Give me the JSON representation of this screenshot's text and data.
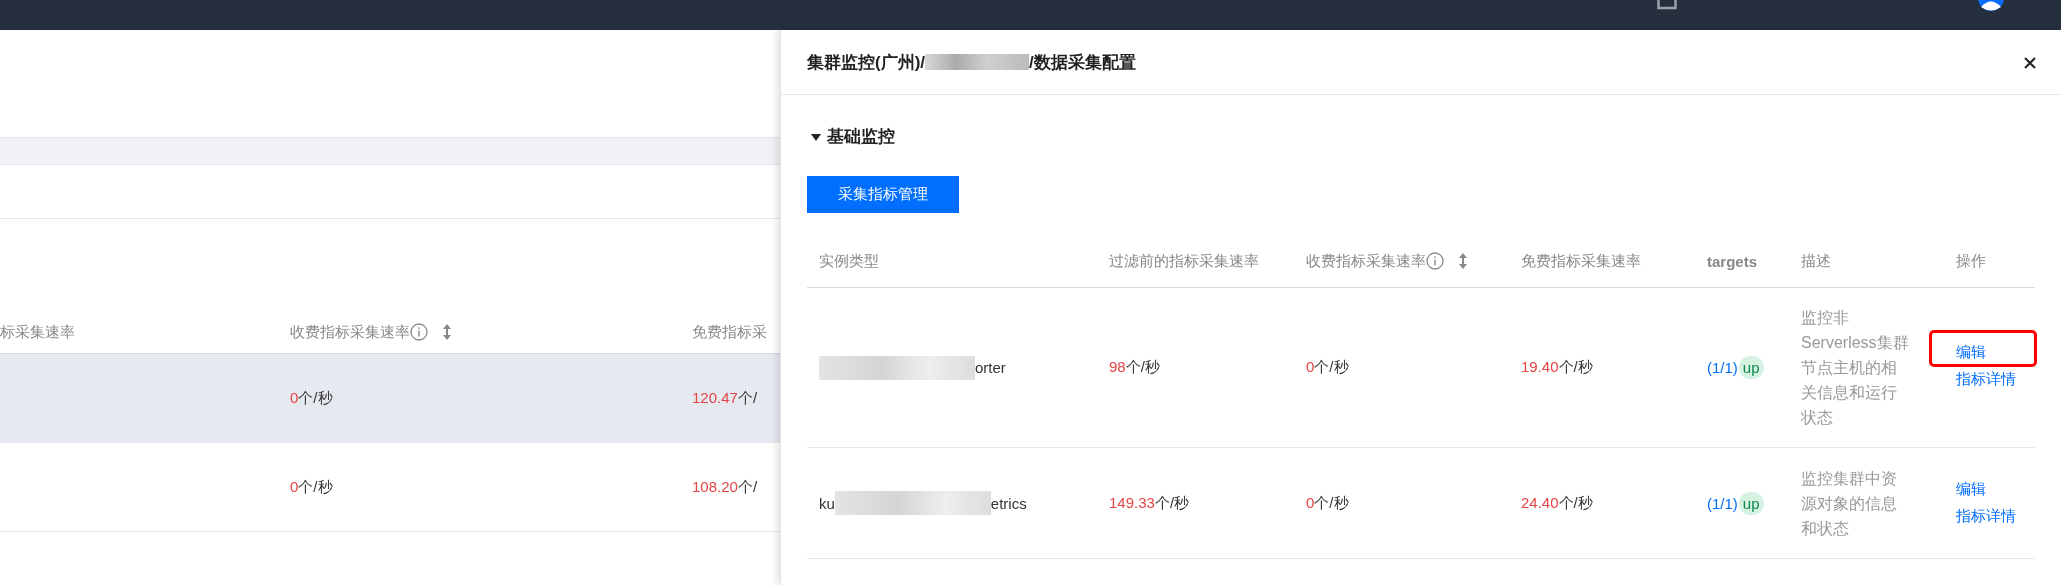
{
  "background_table": {
    "columns": [
      {
        "label": "标采集速率",
        "info": false,
        "sortable": false
      },
      {
        "label": "收费指标采集速率",
        "info": true,
        "sortable": true
      },
      {
        "label": "免费指标采",
        "info": false,
        "sortable": false
      }
    ],
    "rows": [
      {
        "highlighted": true,
        "paid": {
          "value": "0",
          "unit": "个/秒"
        },
        "free": {
          "value": "120.47",
          "unit": "个/"
        }
      },
      {
        "highlighted": false,
        "paid": {
          "value": "0",
          "unit": "个/秒"
        },
        "free": {
          "value": "108.20",
          "unit": "个/"
        }
      }
    ]
  },
  "drawer": {
    "title_before": "集群监控(广州)/",
    "title_after": "/数据采集配置",
    "section": {
      "title": "基础监控",
      "expanded": true
    },
    "button": "采集指标管理",
    "table": {
      "columns": [
        {
          "label": "实例类型",
          "info": false,
          "sortable": false,
          "bold": false
        },
        {
          "label": "过滤前的指标采集速率",
          "info": false,
          "sortable": false,
          "bold": false
        },
        {
          "label": "收费指标采集速率",
          "info": true,
          "sortable": true,
          "bold": false
        },
        {
          "label": "免费指标采集速率",
          "info": false,
          "sortable": false,
          "bold": false
        },
        {
          "label": "targets",
          "info": false,
          "sortable": false,
          "bold": true
        },
        {
          "label": "描述",
          "info": false,
          "sortable": false,
          "bold": false
        },
        {
          "label": "操作",
          "info": false,
          "sortable": false,
          "bold": false
        }
      ],
      "rows": [
        {
          "instance_suffix": "orter",
          "before": {
            "value": "98",
            "unit": "个/秒"
          },
          "paid": {
            "value": "0",
            "unit": "个/秒"
          },
          "free": {
            "value": "19.40",
            "unit": "个/秒"
          },
          "targets": "(1/1)",
          "status": "up",
          "description": "监控非Serverless集群节点主机的相关信息和运行状态",
          "actions": [
            {
              "label": "编辑",
              "highlighted": true
            },
            {
              "label": "指标详情",
              "highlighted": false
            }
          ]
        },
        {
          "instance_prefix": "ku",
          "instance_suffix": "etrics",
          "before": {
            "value": "149.33",
            "unit": "个/秒"
          },
          "paid": {
            "value": "0",
            "unit": "个/秒"
          },
          "free": {
            "value": "24.40",
            "unit": "个/秒"
          },
          "targets": "(1/1)",
          "status": "up",
          "description": "监控集群中资源对象的信息和状态",
          "actions": [
            {
              "label": "编辑",
              "highlighted": false
            },
            {
              "label": "指标详情",
              "highlighted": false
            }
          ]
        }
      ]
    }
  }
}
